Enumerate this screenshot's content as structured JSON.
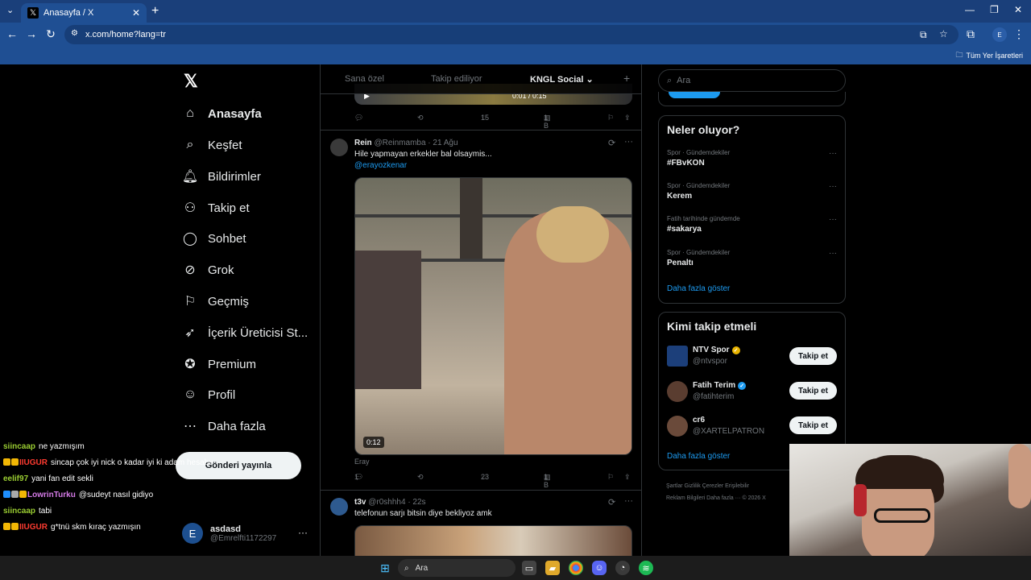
{
  "browser": {
    "tab_title": "Anasayfa / X",
    "url": "x.com/home?lang=tr",
    "bookmarks_label": "Tüm Yer İşaretleri",
    "profile_initial": "E"
  },
  "nav": {
    "items": [
      {
        "label": "Anasayfa",
        "icon": "home-icon"
      },
      {
        "label": "Keşfet",
        "icon": "search-icon"
      },
      {
        "label": "Bildirimler",
        "icon": "bell-icon"
      },
      {
        "label": "Takip et",
        "icon": "person-add-icon"
      },
      {
        "label": "Sohbet",
        "icon": "chat-icon"
      },
      {
        "label": "Grok",
        "icon": "grok-icon"
      },
      {
        "label": "Geçmiş",
        "icon": "bookmark-icon"
      },
      {
        "label": "İçerik Üreticisi St...",
        "icon": "rocket-icon"
      },
      {
        "label": "Premium",
        "icon": "premium-icon"
      },
      {
        "label": "Profil",
        "icon": "profile-icon"
      },
      {
        "label": "Daha fazla",
        "icon": "more-icon"
      }
    ],
    "post_button": "Gönderi yayınla"
  },
  "account": {
    "initial": "E",
    "name": "asdasd",
    "handle": "@Emrelfti1172297"
  },
  "chat": [
    {
      "user": "siincaap",
      "msg": "ne yazmışım",
      "color": "#9acd32",
      "badges": []
    },
    {
      "user": "IIUGUR",
      "msg": "sincap çok iyi nick o kadar iyi ki adam hesabını değiştir",
      "color": "#ff3b30",
      "badges": [
        "#f2b705",
        "#f2b705"
      ]
    },
    {
      "user": "eelif97",
      "msg": "yani fan edit sekli",
      "color": "#9acd32",
      "badges": []
    },
    {
      "user": "LowrinTurku",
      "msg": "@sudeyt nasıl gidiyo",
      "color": "#d67be8",
      "badges": [
        "#1f8fff",
        "#aaaaaa",
        "#f2b705"
      ]
    },
    {
      "user": "siincaap",
      "msg": "tabi",
      "color": "#9acd32",
      "badges": []
    },
    {
      "user": "IIUGUR",
      "msg": "g*tnü skm kıraç yazmışın",
      "color": "#ff3b30",
      "badges": [
        "#f2b705",
        "#f2b705"
      ]
    }
  ],
  "feed": {
    "tabs": [
      "Sana özel",
      "Takip ediliyor",
      "KNGL Social"
    ],
    "plus": "+",
    "prev_video_time": "0:01 / 0:15",
    "prev_actions": {
      "likes": "15",
      "views": "1 B"
    },
    "tweet1": {
      "name": "Rein",
      "handle": "@Reinmamba",
      "date": "· 21 Ağu",
      "text": "Hile yapmayan erkekler bal olsaymis...",
      "mention": "@erayozkenar",
      "duration": "0:12",
      "caption": "Eray",
      "replies": "1",
      "likes": "23",
      "views": "1 B"
    },
    "tweet2": {
      "name": "t3v",
      "handle": "@r0shhh4",
      "date": "· 22s",
      "text": "telefonun sarjı bitsin diye bekliyoz amk"
    }
  },
  "right": {
    "search_placeholder": "Ara",
    "trends_title": "Neler oluyor?",
    "trends": [
      {
        "category": "Spor · Gündemdekiler",
        "name": "#FBvKON"
      },
      {
        "category": "Spor · Gündemdekiler",
        "name": "Kerem"
      },
      {
        "category": "Fatih tarihinde gündemde",
        "name": "#sakarya"
      },
      {
        "category": "Spor · Gündemdekiler",
        "name": "Penaltı"
      }
    ],
    "show_more": "Daha fazla göster",
    "follow_title": "Kimi takip etmeli",
    "follow": [
      {
        "name": "NTV Spor",
        "handle": "@ntvspor",
        "verified_color": "#e8b400"
      },
      {
        "name": "Fatih Terim",
        "handle": "@fatihterim",
        "verified_color": "#1d9bf0"
      },
      {
        "name": "cr6",
        "handle": "@XARTELPATRON",
        "verified_color": ""
      }
    ],
    "follow_button": "Takip et",
    "follow_show_more": "Daha fazla göster",
    "footer_line1": "Şartlar     Gizlilik     Çerezler     Erişilebilir",
    "footer_line2": "Reklam Bilgileri     Daha fazla ···     © 2026 X"
  },
  "taskbar": {
    "search_placeholder": "Ara"
  }
}
